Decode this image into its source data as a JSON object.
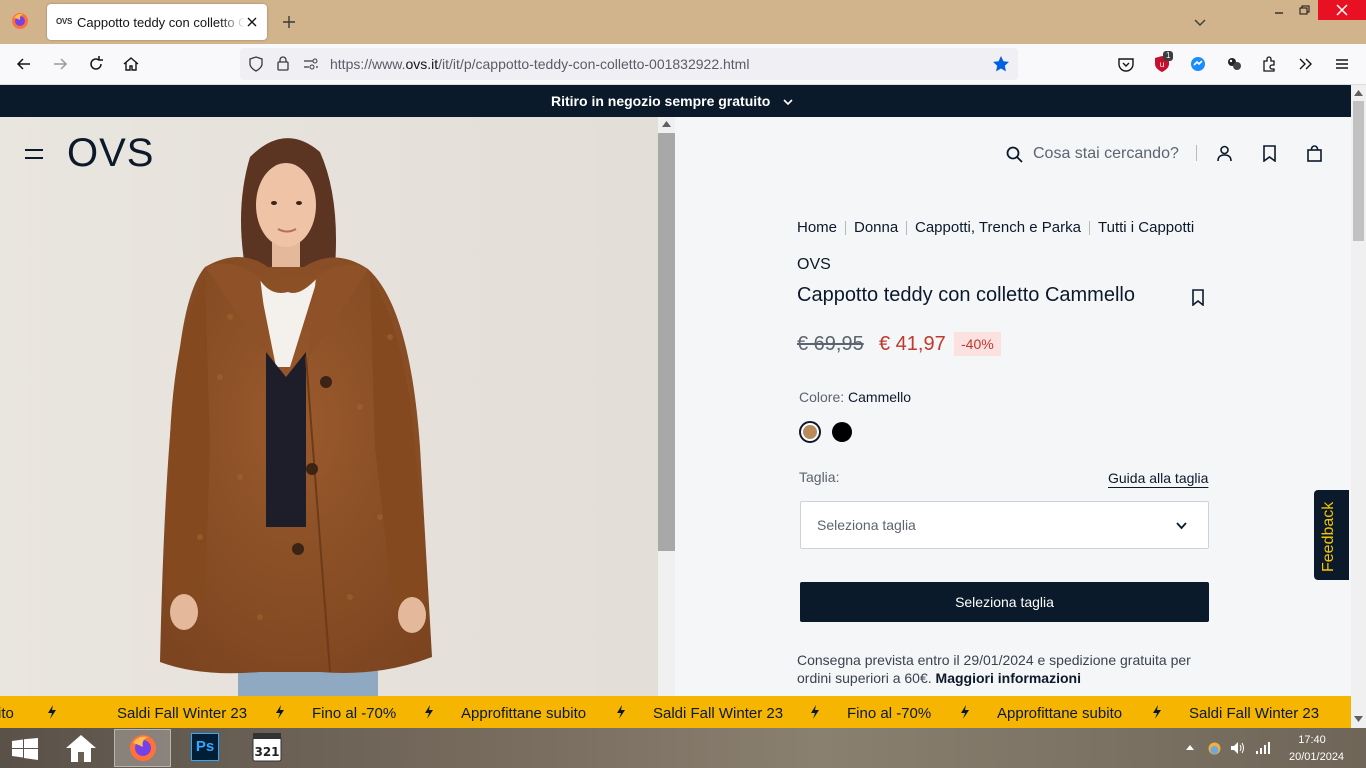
{
  "browser": {
    "tab": {
      "favicon_text": "OVS",
      "title": "Cappotto teddy con colletto Cammello"
    },
    "url_prefix": "https://www.",
    "url_domain": "ovs.it",
    "url_path": "/it/it/p/cappotto-teddy-con-colletto-001832922.html",
    "extension_badge": "1"
  },
  "site": {
    "promo": "Ritiro in negozio sempre gratuito",
    "logo": "OVS",
    "search_placeholder": "Cosa stai cercando?",
    "feedback": "Feedback"
  },
  "breadcrumb": [
    "Home",
    "Donna",
    "Cappotti, Trench e Parka",
    "Tutti i Cappotti"
  ],
  "product": {
    "brand": "OVS",
    "title": "Cappotto teddy con colletto Cammello",
    "old_price": "€ 69,95",
    "new_price": "€ 41,97",
    "discount": "-40%",
    "color_label": "Colore:",
    "color_value": "Cammello",
    "swatches": [
      {
        "name": "Cammello",
        "color": "#b88a5d"
      },
      {
        "name": "Nero",
        "color": "#000000"
      }
    ],
    "size_label": "Taglia:",
    "size_guide": "Guida alla taglia",
    "size_placeholder": "Seleziona taglia",
    "cta": "Seleziona taglia",
    "delivery_text": "Consegna prevista entro il 29/01/2024 e spedizione gratuita per ordini superiori a 60€.",
    "delivery_link": "Maggiori informazioni"
  },
  "ticker": [
    "ito",
    "Saldi Fall Winter 23",
    "Fino al -70%",
    "Approfittane subito",
    "Saldi Fall Winter 23",
    "Fino al -70%",
    "Approfittane subito",
    "Saldi Fall Winter 23"
  ],
  "taskbar": {
    "ps_label": "Ps",
    "time": "17:40",
    "date": "20/01/2024"
  },
  "colors": {
    "navy": "#0b1a2b",
    "sale_red": "#c0392b",
    "ticker_yellow": "#f5b500",
    "titlebar": "#d2b48c"
  }
}
